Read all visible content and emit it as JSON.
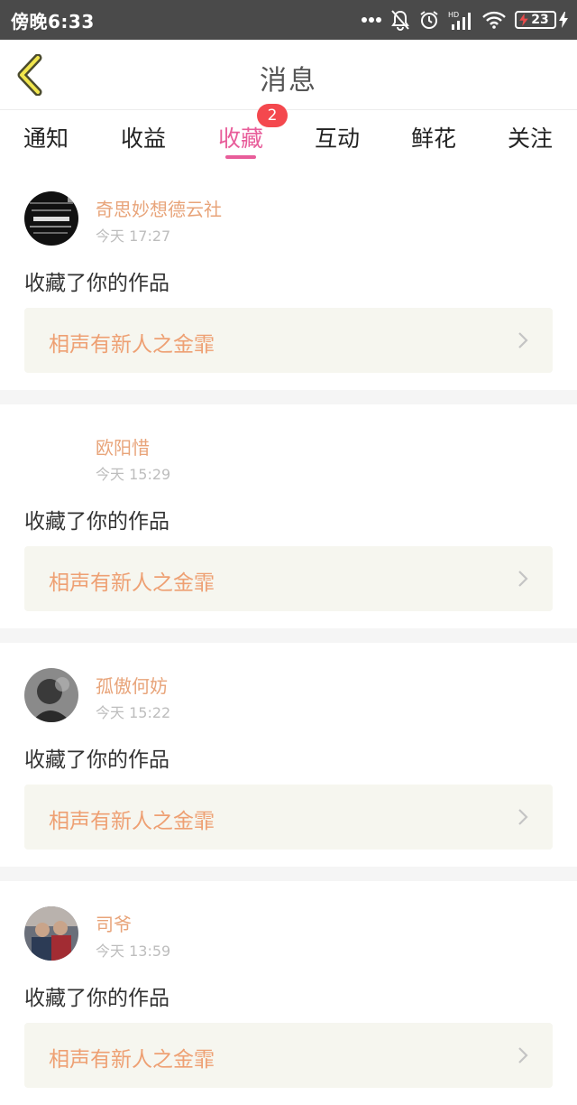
{
  "status_bar": {
    "time": "傍晚6:33",
    "battery_level": "23",
    "icons": [
      "more-dots-icon",
      "bell-off-icon",
      "alarm-icon",
      "hd-signal-icon",
      "wifi-icon",
      "battery-icon",
      "charging-icon"
    ]
  },
  "header": {
    "title": "消息",
    "back_icon": "back-chevron-icon"
  },
  "tabs": [
    {
      "label": "通知"
    },
    {
      "label": "收益"
    },
    {
      "label": "收藏",
      "badge": "2",
      "active": true
    },
    {
      "label": "互动"
    },
    {
      "label": "鲜花"
    },
    {
      "label": "关注"
    }
  ],
  "colors": {
    "accent": "#e85d9a",
    "badge": "#f4484e",
    "username": "#e8a47a",
    "work_title": "#eea073",
    "work_box_bg": "#f6f6ef"
  },
  "feed": [
    {
      "name": "奇思妙想德云社",
      "time": "今天 17:27",
      "action": "收藏了你的作品",
      "work": "相声有新人之金霏"
    },
    {
      "name": "欧阳惜",
      "time": "今天 15:29",
      "action": "收藏了你的作品",
      "work": "相声有新人之金霏"
    },
    {
      "name": "孤傲何妨",
      "time": "今天 15:22",
      "action": "收藏了你的作品",
      "work": "相声有新人之金霏"
    },
    {
      "name": "司爷",
      "time": "今天 13:59",
      "action": "收藏了你的作品",
      "work": "相声有新人之金霏"
    }
  ]
}
